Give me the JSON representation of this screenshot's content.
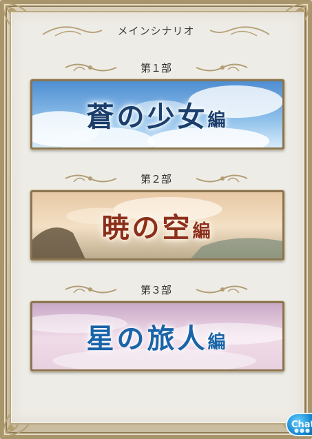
{
  "header": {
    "title": "メインシナリオ"
  },
  "sections": [
    {
      "label": "第１部",
      "banner_main": "蒼の少女",
      "banner_suffix": "編"
    },
    {
      "label": "第２部",
      "banner_main": "暁の空",
      "banner_suffix": "編"
    },
    {
      "label": "第３部",
      "banner_main": "星の旅人",
      "banner_suffix": "編"
    }
  ],
  "chat": {
    "label": "Chat"
  },
  "colors": {
    "panel_bg": "#eeece6",
    "frame_gold": "#b59e70",
    "chat_blue": "#1689d4"
  }
}
